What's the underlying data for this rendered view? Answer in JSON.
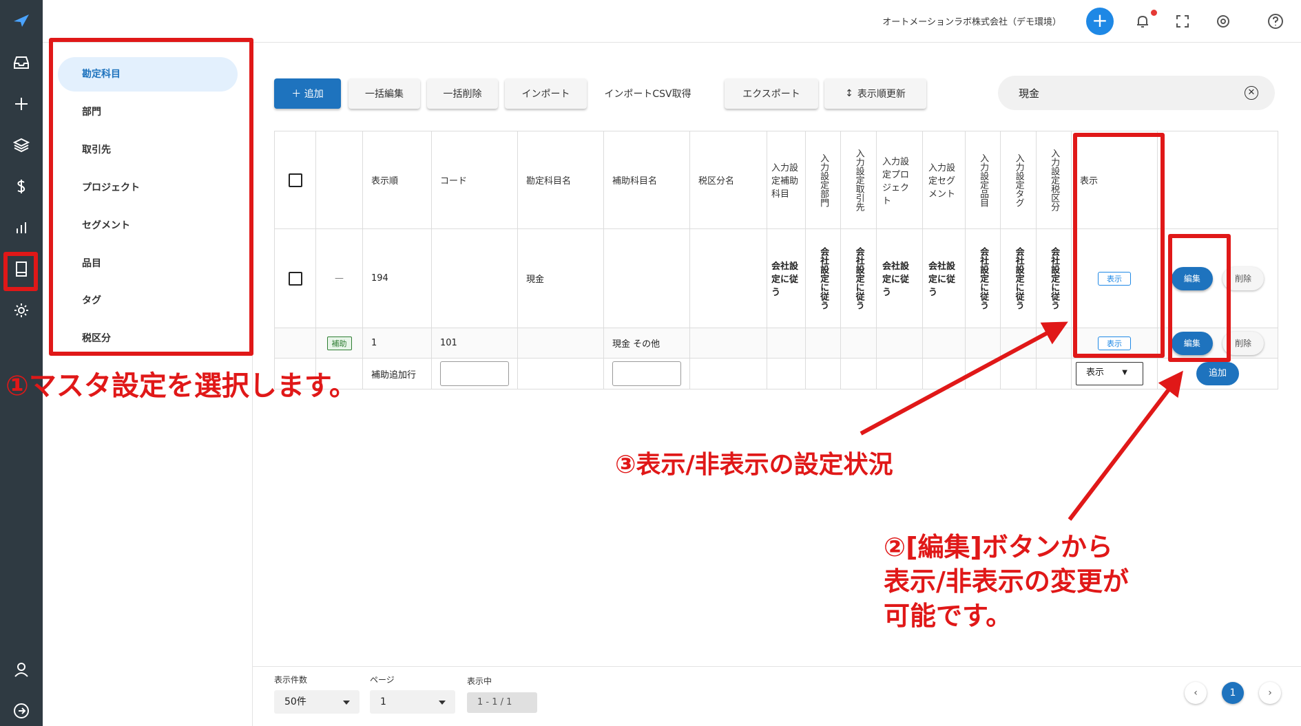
{
  "topbar": {
    "company": "オートメーションラボ株式会社（デモ環境）"
  },
  "sidemenu": {
    "items": [
      {
        "label": "勘定科目",
        "active": true
      },
      {
        "label": "部門"
      },
      {
        "label": "取引先"
      },
      {
        "label": "プロジェクト"
      },
      {
        "label": "セグメント"
      },
      {
        "label": "品目"
      },
      {
        "label": "タグ"
      },
      {
        "label": "税区分"
      }
    ]
  },
  "toolbar": {
    "add": "＋ 追加",
    "bulk_edit": "一括編集",
    "bulk_delete": "一括削除",
    "import": "インポート",
    "import_csv": "インポートCSV取得",
    "export": "エクスポート",
    "reorder": "表示順更新"
  },
  "search": {
    "value": "現金"
  },
  "table": {
    "headers": {
      "order": "表示順",
      "code": "コード",
      "account": "勘定科目名",
      "sub_account": "補助科目名",
      "tax": "税区分名",
      "in_sub": "入力設定補助科目",
      "in_dept": "入力設定部門",
      "in_partner": "入力設定取引先",
      "in_project": "入力設定プロジェクト",
      "in_segment": "入力設定セグメント",
      "in_item": "入力設定品目",
      "in_tag": "入力設定タグ",
      "in_tax": "入力設定税区分",
      "display": "表示"
    },
    "row1": {
      "dash": "—",
      "order": "194",
      "account": "現金",
      "in_sub": "会社設定に従う",
      "in_dept": "会社設定に従う",
      "in_partner": "会社設定に従う",
      "in_project": "会社設定に従う",
      "in_segment": "会社設定に従う",
      "in_item": "会社設定に従う",
      "in_tag": "会社設定に従う",
      "in_tax": "会社設定に従う",
      "display": "表示",
      "edit": "編集",
      "delete": "削除"
    },
    "row2": {
      "badge": "補助",
      "order": "1",
      "code": "101",
      "sub_account": "現金 その他",
      "display": "表示",
      "edit": "編集",
      "delete": "削除"
    },
    "row3": {
      "label": "補助追加行",
      "select": "表示",
      "add": "追加"
    }
  },
  "footer": {
    "per_page_label": "表示件数",
    "per_page": "50件",
    "page_label": "ページ",
    "page": "1",
    "showing_label": "表示中",
    "showing": "1 - 1 / 1",
    "prev": "‹",
    "current": "1",
    "next": "›"
  },
  "annotations": {
    "a1": "①マスタ設定を選択します。",
    "a2_line1": "②[編集]ボタンから",
    "a2_line2": "表示/非表示の変更が",
    "a2_line3": "可能です。",
    "a3": "③表示/非表示の設定状況"
  },
  "colors": {
    "accent": "#1e73be",
    "annotation": "#e01818",
    "rail": "#2f3a42"
  }
}
